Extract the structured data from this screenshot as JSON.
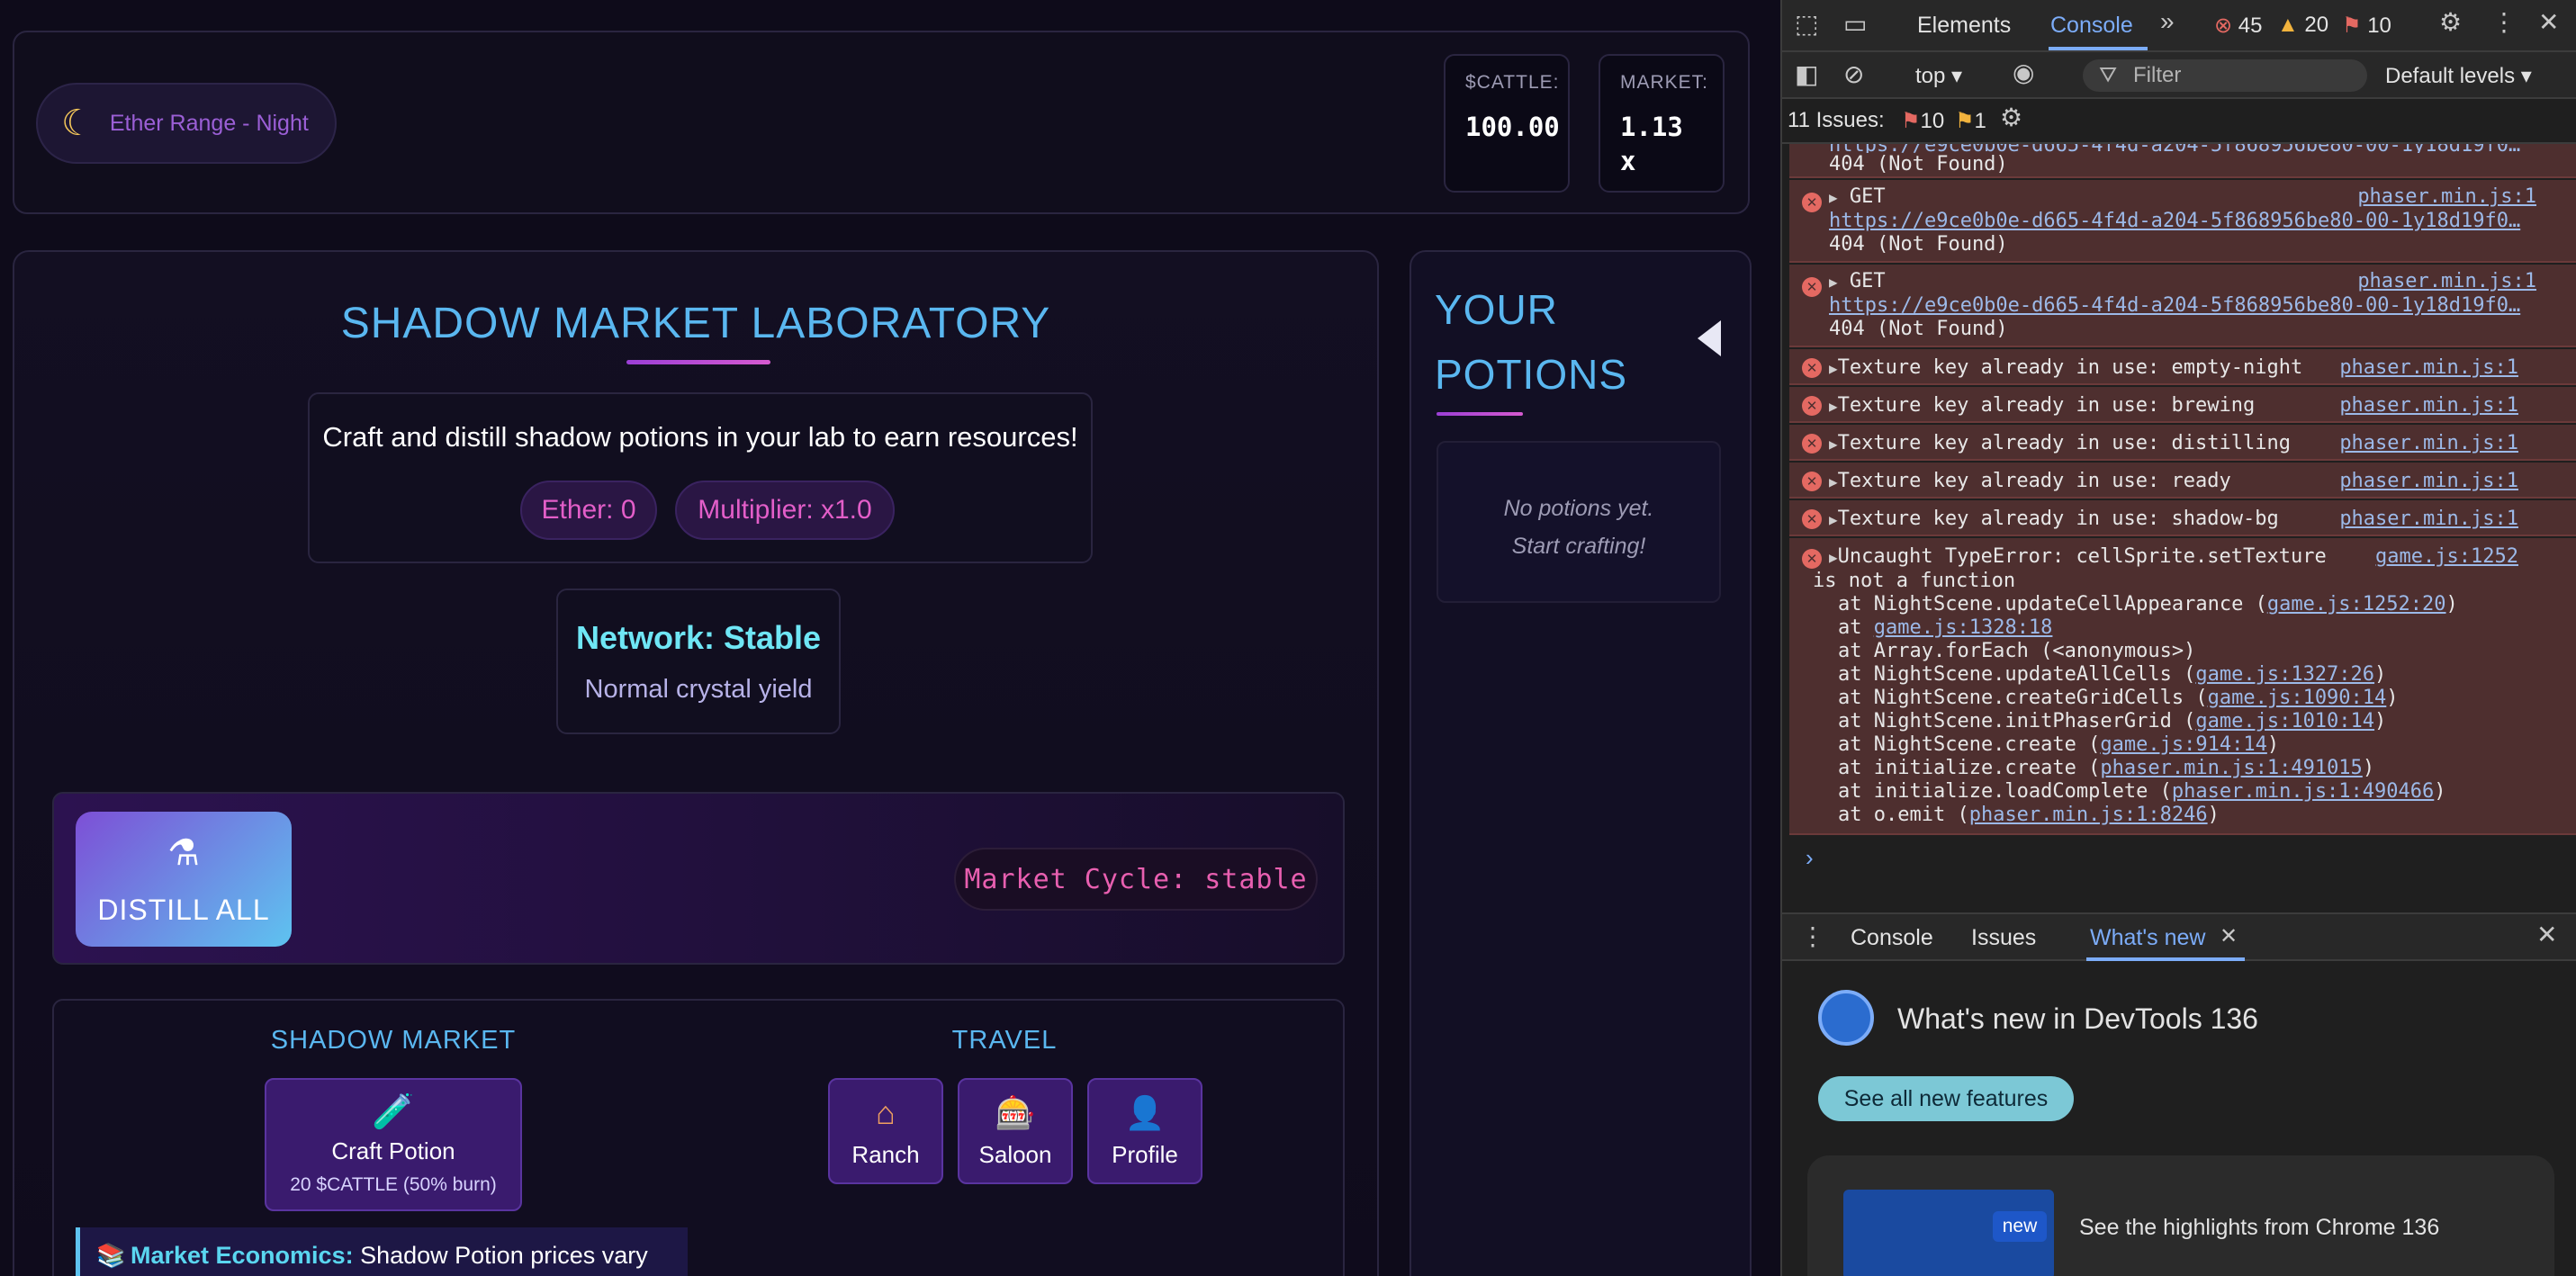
{
  "game": {
    "location": "Ether Range - Night",
    "stats": {
      "cattle_label": "$CATTLE:",
      "cattle_value": "100.00",
      "market_label": "MARKET:",
      "market_value": "1.13",
      "market_unit": "x"
    },
    "lab": {
      "title": "SHADOW MARKET LABORATORY",
      "intro": "Craft and distill shadow potions in your lab to earn resources!",
      "ether": "Ether: 0",
      "multiplier": "Multiplier: x1.0",
      "network_title": "Network: Stable",
      "network_sub": "Normal crystal yield",
      "distill_label": "DISTILL ALL",
      "market_cycle": "Market Cycle: stable"
    },
    "shadow_market": {
      "heading": "SHADOW MARKET",
      "craft_label": "Craft Potion",
      "craft_cost": "20 $CATTLE (50% burn)"
    },
    "travel": {
      "heading": "TRAVEL",
      "items": [
        {
          "label": "Ranch",
          "icon": "house-icon"
        },
        {
          "label": "Saloon",
          "icon": "slot-machine-icon"
        },
        {
          "label": "Profile",
          "icon": "user-icon"
        }
      ]
    },
    "economics": {
      "bold": "Market Economics:",
      "text": " Shadow Potion prices vary"
    },
    "potions": {
      "title": "YOUR POTIONS",
      "empty_line1": "No potions yet.",
      "empty_line2": "Start crafting!"
    }
  },
  "devtools": {
    "tabs": [
      "Elements",
      "Console"
    ],
    "active_tab": "Console",
    "counts": {
      "errors": "45",
      "warnings": "20",
      "info": "10"
    },
    "context": "top",
    "filter_placeholder": "Filter",
    "levels": "Default levels",
    "issues_label": "11 Issues:",
    "issues_errors": "10",
    "issues_warnings": "1",
    "logs": [
      {
        "text": "404 (Not Found)",
        "url": "https://e9ce0b0e-d665-4f4d-a204-5f868956be80-00-1y18d19f0…",
        "partial": true
      },
      {
        "method": "GET",
        "source": "phaser.min.js:1",
        "url": "https://e9ce0b0e-d665-4f4d-a204-5f868956be80-00-1y18d19f0…",
        "status": "404 (Not Found)"
      },
      {
        "method": "GET",
        "source": "phaser.min.js:1",
        "url": "https://e9ce0b0e-d665-4f4d-a204-5f868956be80-00-1y18d19f0…",
        "status": "404 (Not Found)"
      }
    ],
    "texture_errors": [
      {
        "text": "Texture key already in use: empty-night",
        "source": "phaser.min.js:1"
      },
      {
        "text": "Texture key already in use: brewing",
        "source": "phaser.min.js:1"
      },
      {
        "text": "Texture key already in use: distilling",
        "source": "phaser.min.js:1"
      },
      {
        "text": "Texture key already in use: ready",
        "source": "phaser.min.js:1"
      },
      {
        "text": "Texture key already in use: shadow-bg",
        "source": "phaser.min.js:1"
      }
    ],
    "type_error": {
      "line1": "Uncaught TypeError: cellSprite.setTexture",
      "source": "game.js:1252",
      "line2": "is not a function",
      "stack": [
        {
          "pre": "at NightScene.updateCellAppearance (",
          "link": "game.js:1252:20",
          "post": ")"
        },
        {
          "pre": "at ",
          "link": "game.js:1328:18",
          "post": ""
        },
        {
          "pre": "at Array.forEach (<anonymous>)",
          "link": "",
          "post": ""
        },
        {
          "pre": "at NightScene.updateAllCells (",
          "link": "game.js:1327:26",
          "post": ")"
        },
        {
          "pre": "at NightScene.createGridCells (",
          "link": "game.js:1090:14",
          "post": ")"
        },
        {
          "pre": "at NightScene.initPhaserGrid (",
          "link": "game.js:1010:14",
          "post": ")"
        },
        {
          "pre": "at NightScene.create (",
          "link": "game.js:914:14",
          "post": ")"
        },
        {
          "pre": "at initialize.create (",
          "link": "phaser.min.js:1:491015",
          "post": ")"
        },
        {
          "pre": "at initialize.loadComplete (",
          "link": "phaser.min.js:1:490466",
          "post": ")"
        },
        {
          "pre": "at o.emit (",
          "link": "phaser.min.js:1:8246",
          "post": ")"
        }
      ]
    },
    "prompt": "›",
    "drawer_tabs": [
      "Console",
      "Issues",
      "What's new"
    ],
    "whats_new": {
      "title": "What's new in DevTools 136",
      "button": "See all new features",
      "badge": "new",
      "highlight": "See the highlights from Chrome 136"
    }
  }
}
